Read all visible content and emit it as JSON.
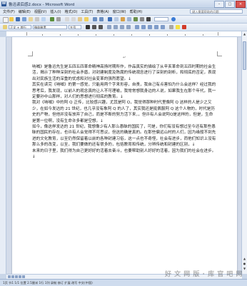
{
  "window": {
    "title": "鲁迅读后感2.docx - Microsoft Word",
    "buttons": {
      "minimize": "–",
      "maximize": "□",
      "close": "×"
    }
  },
  "menubar": {
    "items": [
      "文件(F)",
      "编辑(E)",
      "视图(V)",
      "插入(I)",
      "格式(O)",
      "工具(T)",
      "表格(A)",
      "窗口(W)",
      "帮助(H)"
    ],
    "help_placeholder": "键入需要帮助的问题"
  },
  "format_toolbar": {
    "style": "正文 + 首行",
    "font": "微软雅黑",
    "size": "五号"
  },
  "document": {
    "cursor_mark": "↵",
    "paragraphs": [
      "呐喊》是鲁迅先生是五四五四革命精神高扬时期所作，作品真实的描绘了从辛亥革命到五四时期的社会生活，揭示了种种深刻的社会矛盾，对封建制度及陈腐的传统观念进行了深刻的剖析，和彻底的否定，表现出对民族生活的深重的忧虑和对社会变革的强烈愿望。↓",
      "其实在读完《呐喊》的第一感觉，只能用两个字来形容，自责，我自己有点害怕为什么会这样？经过我的思考后，我发现，以前人的观念真的让人不可理喻，我常常想我身边的人说，如果我生在那个年代，我一定要孙中山那样，对人们的思想进行彻底的教育。↓",
      "我对《呐喊》中的阿 Q 正传，比较感兴趣，尤其是阿 Q，我觉得那种时代里像阿 Q 这样的人是少之又少，在如今发达的 21 世纪，也几乎没有象阿 Q 的人了，其实我还是挺佩服阿 Q 这个人物的，时代是历史的产物，但他并没有放弃了自己，而是不断的努力活下来，，但许有人会说阿Q是这样的，但是，生命是第一位啊，没有生命许多都是空想。↓",
      "如今，像这样发达的 21 世纪，我想像少有人那么愚昧的国民了，可是，你们有没有想过至今还有那些愚昧的国民的存在，也许有人会觉得不可思议，但这的确是真的。在那些偏远山村的人们，因为缘般不到先进的文化教育，以至仍然保留着以前的各种封建习俗，这一点也不奇怪，社会有进步，而他们知识上没有那么多的改变，以至，我们要做的还有很多的，包括教育和传统，分辨传统和封建的区别，↓",
      "未来的日子里，我们得为自己更好好的活着去奋斗，也要帮助别人好好的活着，因为我们的社会在进步。↓"
    ]
  },
  "statusbar": {
    "text": "1页  节1  1/1  位置 2.5厘米  1行  1列  录制  修订  扩展  改写  中文(中国)"
  },
  "watermark": "好 文 网 版 · 库 官 吧 网"
}
